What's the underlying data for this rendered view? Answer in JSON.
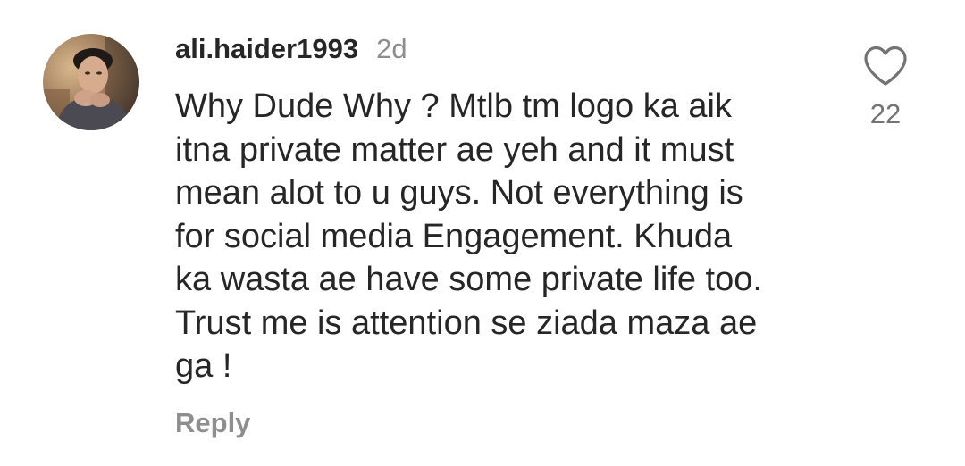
{
  "comment": {
    "username": "ali.haider1993",
    "time": "2d",
    "text": "Why Dude Why ? Mtlb tm logo ka aik\nitna private matter ae yeh and it must\nmean alot to u guys. Not everything is\nfor social media Engagement. Khuda\nka wasta ae have some private life too.\nTrust me is attention se ziada maza ae\nga !",
    "reply_label": "Reply",
    "like_count": "22",
    "like_icon": "heart-outline-icon",
    "avatar_icon": "user-avatar-photo"
  },
  "colors": {
    "primary_text": "#262626",
    "secondary_text": "#8e8e8e",
    "like_count_text": "#737373",
    "background": "#ffffff"
  }
}
